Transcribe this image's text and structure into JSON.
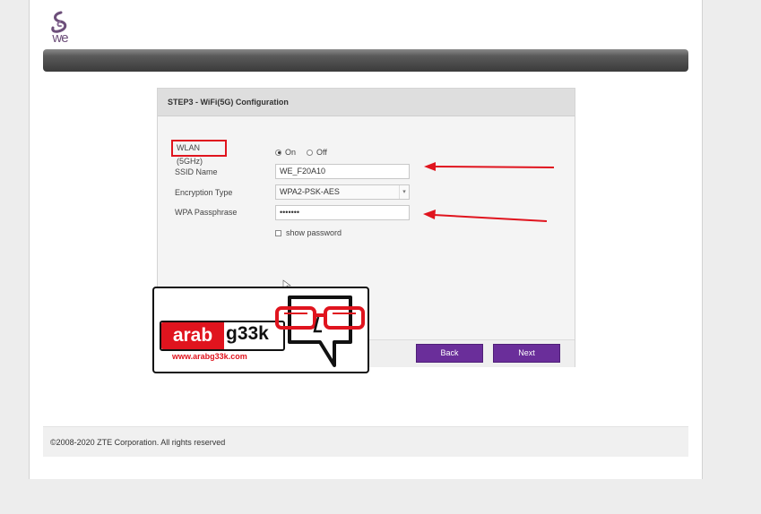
{
  "brand": {
    "logo_text": "we",
    "accent": "#6a2e9a"
  },
  "wizard": {
    "title": "STEP3 - WiFi(5G) Configuration",
    "fields": {
      "wlan_label": "WLAN (5GHz)",
      "wlan_on": "On",
      "wlan_off": "Off",
      "wlan_selected": "On",
      "ssid_label": "SSID Name",
      "ssid_value": "WE_F20A10",
      "encryption_label": "Encryption Type",
      "encryption_value": "WPA2-PSK-AES",
      "passphrase_label": "WPA Passphrase",
      "passphrase_value": "•••••••",
      "show_password_label": "show password"
    },
    "back_label": "Back",
    "next_label": "Next"
  },
  "footer": {
    "copyright": "©2008-2020 ZTE Corporation. All rights reserved"
  },
  "watermark": {
    "brand_part1": "arab",
    "brand_part2": "g33k",
    "url": "www.arabg33k.com",
    "accent": "#e0141e"
  }
}
